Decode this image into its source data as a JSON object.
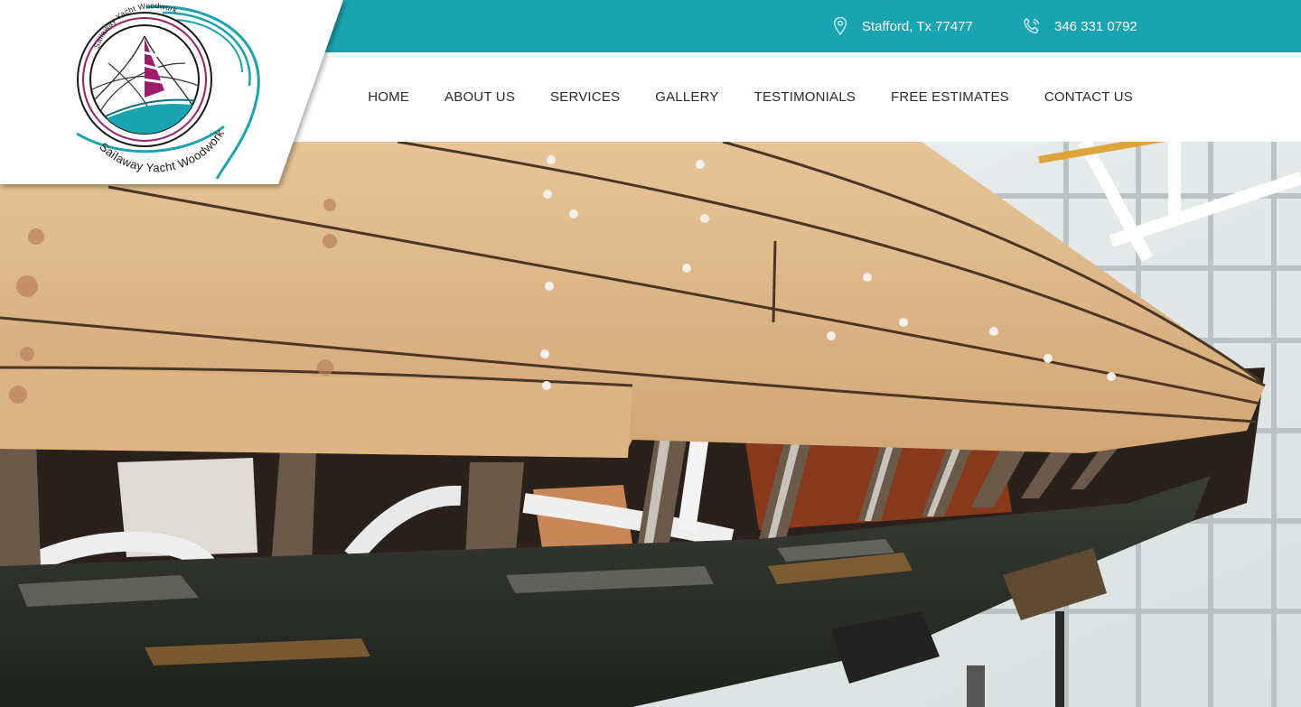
{
  "brand": {
    "name": "Sailaway Yacht Woodwork",
    "colors": {
      "teal": "#1aa3b1",
      "magenta": "#9b1d6c",
      "dark": "#2b2b2b"
    }
  },
  "topbar": {
    "location": {
      "icon": "map-pin-icon",
      "text": "Stafford, Tx 77477"
    },
    "phone": {
      "icon": "phone-icon",
      "text": "346 331 0792"
    }
  },
  "nav": {
    "items": [
      {
        "label": "HOME"
      },
      {
        "label": "ABOUT US"
      },
      {
        "label": "SERVICES"
      },
      {
        "label": "GALLERY"
      },
      {
        "label": "TESTIMONIALS"
      },
      {
        "label": "FREE ESTIMATES"
      },
      {
        "label": "CONTACT US"
      }
    ]
  }
}
